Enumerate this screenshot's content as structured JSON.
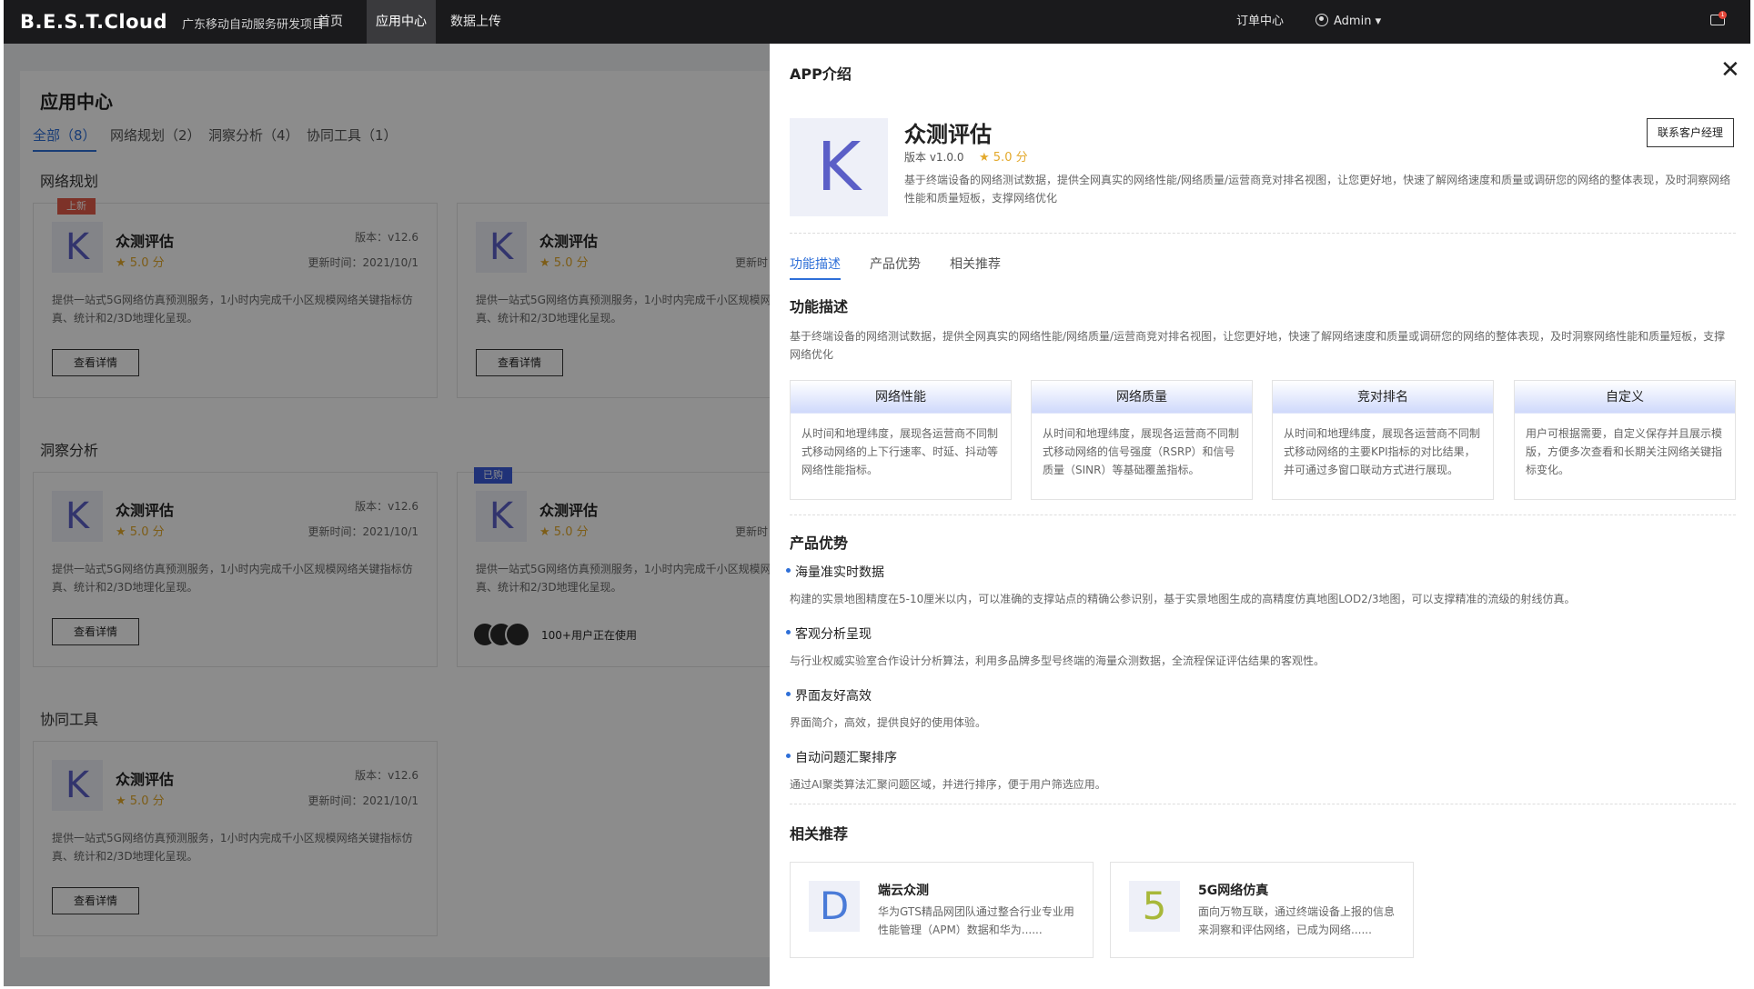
{
  "topbar": {
    "logo": "B.E.S.T.Cloud",
    "project": "广东移动自动服务研发项目",
    "nav": [
      "首页",
      "应用中心",
      "数据上传"
    ],
    "orders": "订单中心",
    "user": "Admin ▾",
    "mail_badge": "1"
  },
  "main": {
    "title": "应用中心",
    "filters": [
      "全部（8）",
      "网络规划（2）",
      "洞察分析（4）",
      "协同工具（1）"
    ],
    "sections": [
      "网络规划",
      "洞察分析",
      "协同工具"
    ],
    "card": {
      "name": "众测评估",
      "rating": "★ 5.0 分",
      "version": "版本：v12.6",
      "updated": "更新时间：2021/10/1",
      "updated_cut": "更新时",
      "desc": "提供一站式5G网络仿真预测服务，1小时内完成千小区规模网络关键指标仿真、统计和2/3D地理化呈现。",
      "detail_button": "查看详情",
      "icon_letter": "K"
    },
    "tag_new": "上新",
    "tag_bought": "已购",
    "users_text": "100+用户正在使用"
  },
  "drawer": {
    "title": "APP介绍",
    "app_name": "众测评估",
    "app_version": "版本 v1.0.0",
    "app_rating": "★ 5.0 分",
    "app_desc": "基于终端设备的网络测试数据，提供全网真实的网络性能/网络质量/运营商竞对排名视图，让您更好地，快速了解网络速度和质量或调研您的网络的整体表现，及时洞察网络性能和质量短板，支撑网络优化",
    "contact_button": "联系客户经理",
    "tabs": [
      "功能描述",
      "产品优势",
      "相关推荐"
    ],
    "func_title": "功能描述",
    "func_desc": "基于终端设备的网络测试数据，提供全网真实的网络性能/网络质量/运营商竞对排名视图，让您更好地，快速了解网络速度和质量或调研您的网络的整体表现，及时洞察网络性能和质量短板，支撑网络优化",
    "features": [
      {
        "title": "网络性能",
        "desc": "从时间和地理纬度，展现各运营商不同制式移动网络的上下行速率、时延、抖动等网络性能指标。"
      },
      {
        "title": "网络质量",
        "desc": "从时间和地理纬度，展现各运营商不同制式移动网络的信号强度（RSRP）和信号质量（SINR）等基础覆盖指标。"
      },
      {
        "title": "竞对排名",
        "desc": "从时间和地理纬度，展现各运营商不同制式移动网络的主要KPI指标的对比结果，并可通过多窗口联动方式进行展现。"
      },
      {
        "title": "自定义",
        "desc": "用户可根据需要，自定义保存并且展示模版，方便多次查看和长期关注网络关键指标变化。"
      }
    ],
    "adv_title": "产品优势",
    "advantages": [
      {
        "title": "海量准实时数据",
        "desc": "构建的实景地图精度在5-10厘米以内，可以准确的支撑站点的精确公参识别，基于实景地图生成的高精度仿真地图LOD2/3地图，可以支撑精准的流级的射线仿真。"
      },
      {
        "title": "客观分析呈现",
        "desc": "与行业权威实验室合作设计分析算法，利用多品牌多型号终端的海量众测数据，全流程保证评估结果的客观性。"
      },
      {
        "title": "界面友好高效",
        "desc": "界面简介，高效，提供良好的使用体验。"
      },
      {
        "title": "自动问题汇聚排序",
        "desc": "通过AI聚类算法汇聚问题区域，并进行排序，便于用户筛选应用。"
      }
    ],
    "rec_title": "相关推荐",
    "recommendations": [
      {
        "letter": "D",
        "name": "端云众测",
        "desc": "华为GTS精品网团队通过整合行业专业用性能管理（APM）数据和华为......",
        "color": "#4a7bd8"
      },
      {
        "letter": "5",
        "name": "5G网络仿真",
        "desc": "面向万物互联，通过终端设备上报的信息来洞察和评估网络，已成为网络......",
        "color": "#a8b83a"
      }
    ]
  }
}
